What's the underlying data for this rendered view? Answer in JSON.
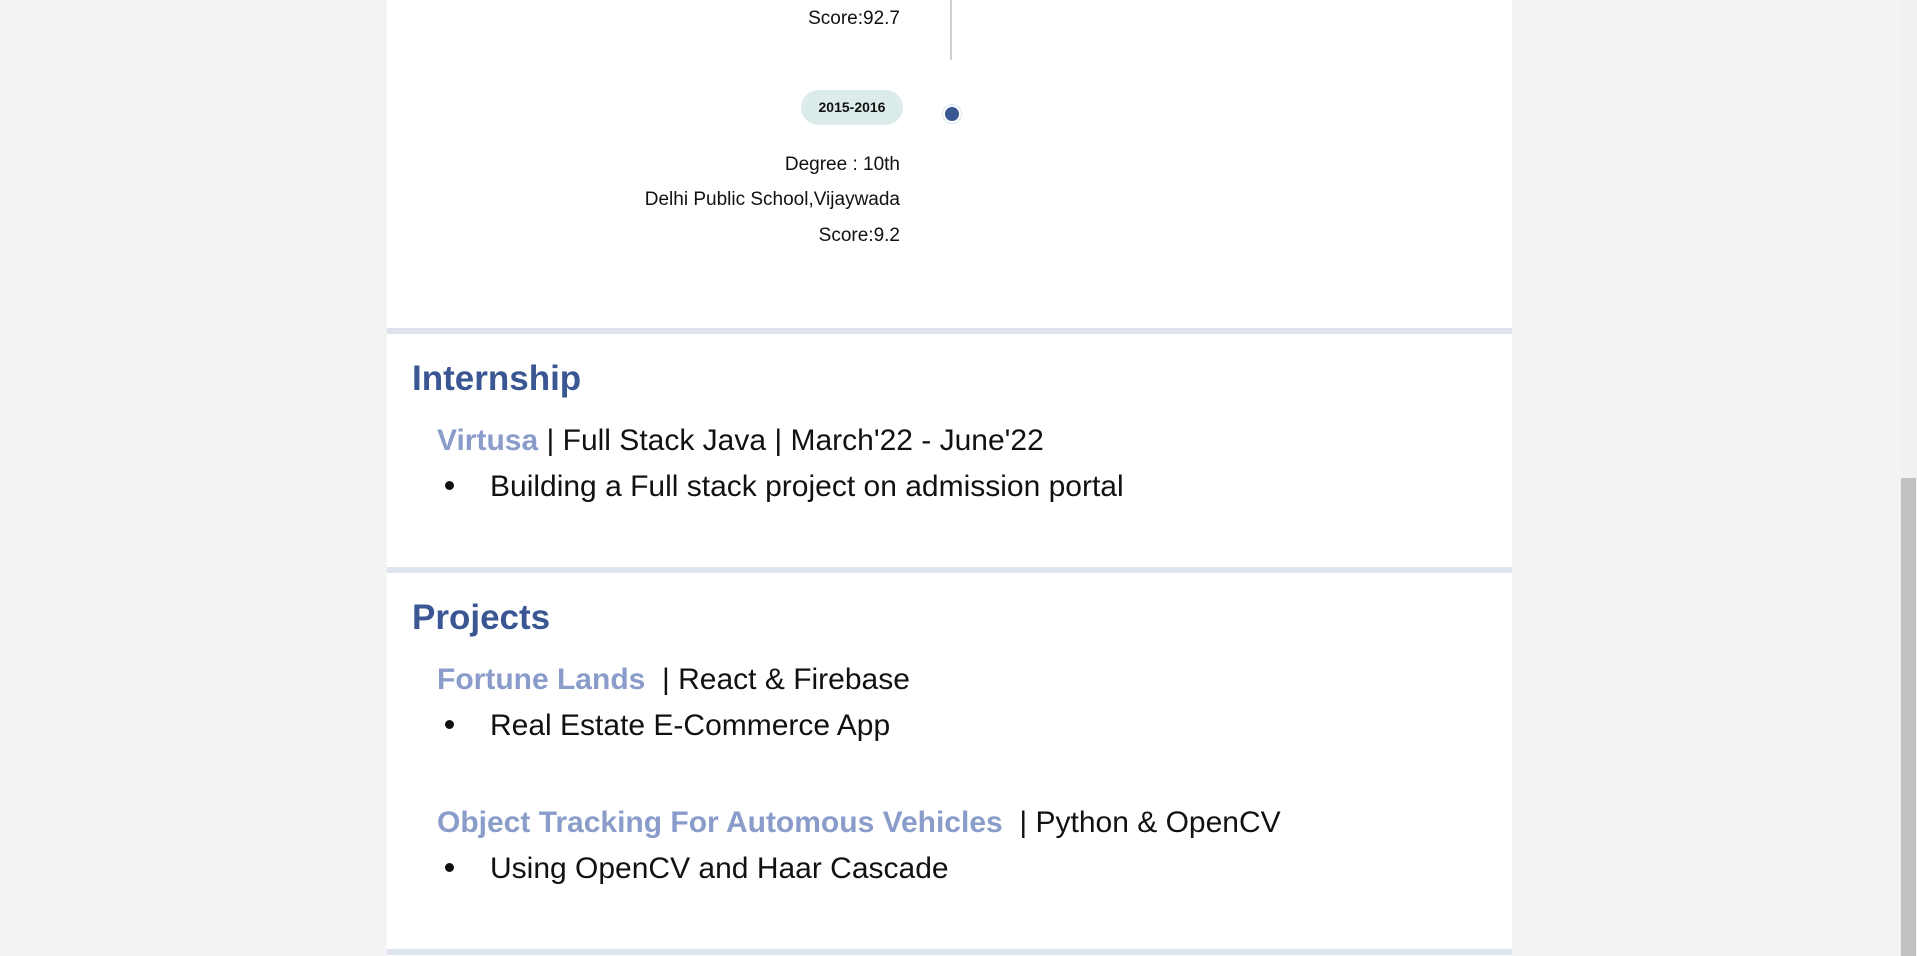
{
  "education": {
    "prev_score": "Score:92.7",
    "entry": {
      "years": "2015-2016",
      "degree": "Degree : 10th",
      "school": "Delhi Public School,Vijaywada",
      "score": "Score:9.2"
    }
  },
  "internship": {
    "title": "Internship",
    "items": [
      {
        "name": "Virtusa",
        "details": " | Full Stack Java | March'22 - June'22",
        "bullets": [
          "Building a Full stack project on admission portal"
        ]
      }
    ]
  },
  "projects": {
    "title": "Projects",
    "items": [
      {
        "name": "Fortune Lands",
        "details": "  | React & Firebase",
        "bullets": [
          "Real Estate E-Commerce App"
        ]
      },
      {
        "name": "Object Tracking For Automous Vehicles",
        "details": "  | Python & OpenCV",
        "bullets": [
          "Using OpenCV and Haar Cascade"
        ]
      }
    ]
  },
  "colors": {
    "accent": "#3a5794",
    "item_name": "#8a9cc9",
    "badge_bg": "#dbeceb",
    "divider": "#dfe3ee"
  }
}
